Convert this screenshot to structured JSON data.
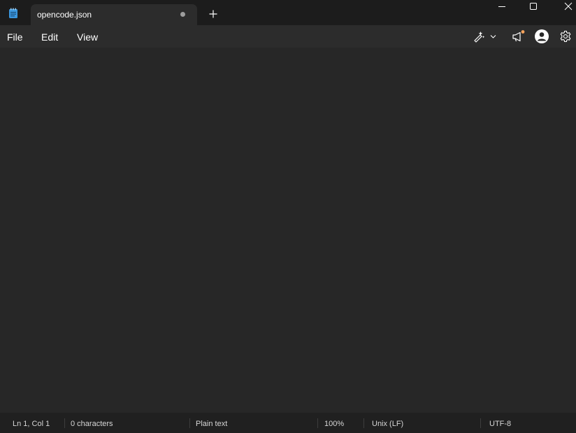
{
  "window": {
    "app_icon": "notepad-icon",
    "tab_title": "opencode.json",
    "tab_modified_indicator": "dot-icon",
    "new_tab_icon": "plus-icon",
    "minimize_icon": "minimize-icon",
    "maximize_icon": "maximize-icon",
    "close_icon": "close-icon"
  },
  "menu": {
    "file": "File",
    "edit": "Edit",
    "view": "View"
  },
  "toolbar": {
    "copilot_icon": "copilot-pen-icon",
    "whats_new_icon": "megaphone-icon",
    "account_icon": "account-icon",
    "settings_icon": "gear-icon"
  },
  "editor": {
    "content": ""
  },
  "status_bar": {
    "position": "Ln 1, Col 1",
    "characters": "0 characters",
    "format": "Plain text",
    "zoom": "100%",
    "line_ending": "Unix (LF)",
    "encoding": "UTF-8"
  },
  "colors": {
    "titlebar": "#1c1c1c",
    "active_tab": "#2c2c2c",
    "editor": "#272727",
    "statusbar": "#202020",
    "notification_dot": "#f7a35c",
    "notepad_icon": "#3a96dd"
  }
}
